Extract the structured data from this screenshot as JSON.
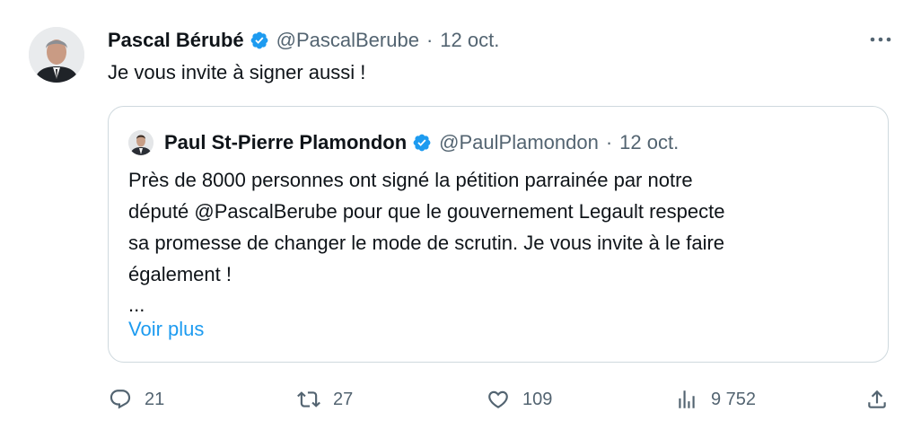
{
  "tweet": {
    "author_name": "Pascal Bérubé",
    "author_handle": "@PascalBerube",
    "separator": "·",
    "date": "12 oct.",
    "text": "Je vous invite à signer aussi !",
    "verified_color": "#1d9bf0"
  },
  "quote": {
    "author_name": "Paul St-Pierre Plamondon",
    "author_handle": "@PaulPlamondon",
    "separator": "·",
    "date": "12 oct.",
    "lines": [
      "Près de 8000 personnes ont signé la pétition parrainée par notre",
      "député @PascalBerube pour que le gouvernement Legault respecte",
      "sa promesse de changer le mode de scrutin. Je vous invite à le faire",
      "également !"
    ],
    "ellipsis": "...",
    "show_more": "Voir plus"
  },
  "actions": {
    "reply_count": "21",
    "retweet_count": "27",
    "like_count": "109",
    "views_count": "9 752"
  },
  "icons": {
    "more": "more-horizontal-icon",
    "reply": "reply-icon",
    "retweet": "retweet-icon",
    "like": "heart-icon",
    "views": "views-icon",
    "share": "share-icon",
    "verified": "verified-badge-icon"
  },
  "colors": {
    "text": "#0f1419",
    "secondary": "#536471",
    "accent": "#1d9bf0",
    "border": "#cfd9de"
  }
}
